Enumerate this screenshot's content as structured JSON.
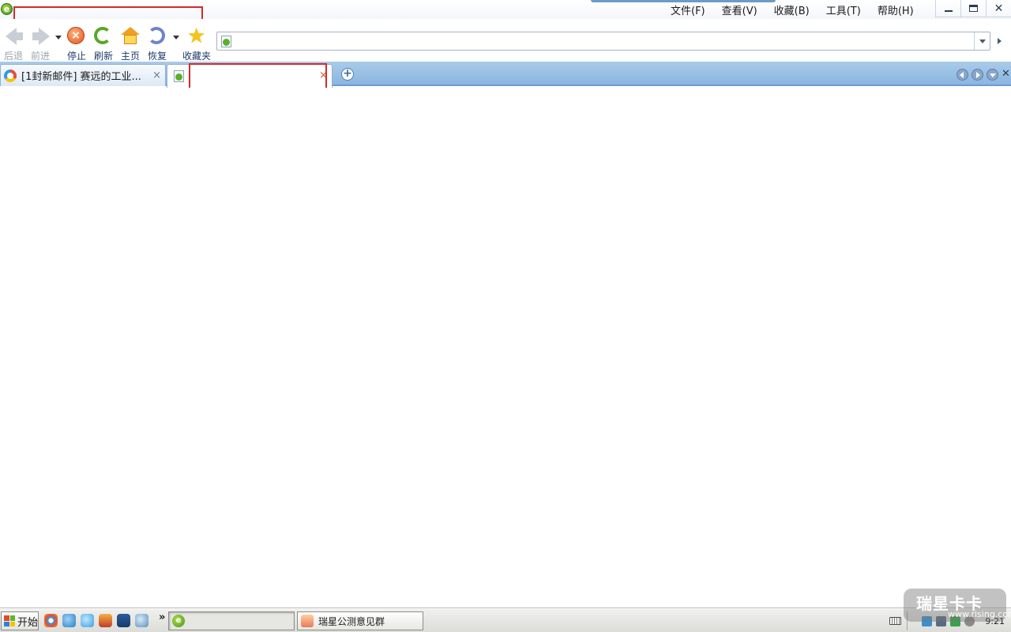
{
  "window": {
    "menu": [
      {
        "label": "文件(F)"
      },
      {
        "label": "查看(V)"
      },
      {
        "label": "收藏(B)"
      },
      {
        "label": "工具(T)"
      },
      {
        "label": "帮助(H)"
      }
    ],
    "minimize_glyph": "_",
    "maximize_glyph": "❐",
    "close_glyph": "✕"
  },
  "toolbar": {
    "back_label": "后退",
    "forward_label": "前进",
    "stop_label": "停止",
    "refresh_label": "刷新",
    "home_label": "主页",
    "restore_label": "恢复",
    "favorites_label": "收藏夹"
  },
  "address_bar": {
    "value": "",
    "placeholder": ""
  },
  "tabs": [
    {
      "title": "[1封新邮件] 赛远的工业...",
      "close": "×",
      "active": false
    },
    {
      "title": "",
      "close": "×",
      "active": true
    }
  ],
  "new_tab_glyph": "+",
  "taskbar": {
    "start_label": "开始",
    "more_glyph": "»",
    "tasks": [
      {
        "label": ""
      },
      {
        "label": "瑞星公测意见群"
      }
    ],
    "clock": "9:21"
  },
  "watermark": {
    "main": "瑞星卡卡",
    "sub": "www.rising.com"
  },
  "colors": {
    "tab_bar": "#8ab6e0",
    "highlight_box": "#d42a2a",
    "taskbar": "#dcdcd8"
  }
}
